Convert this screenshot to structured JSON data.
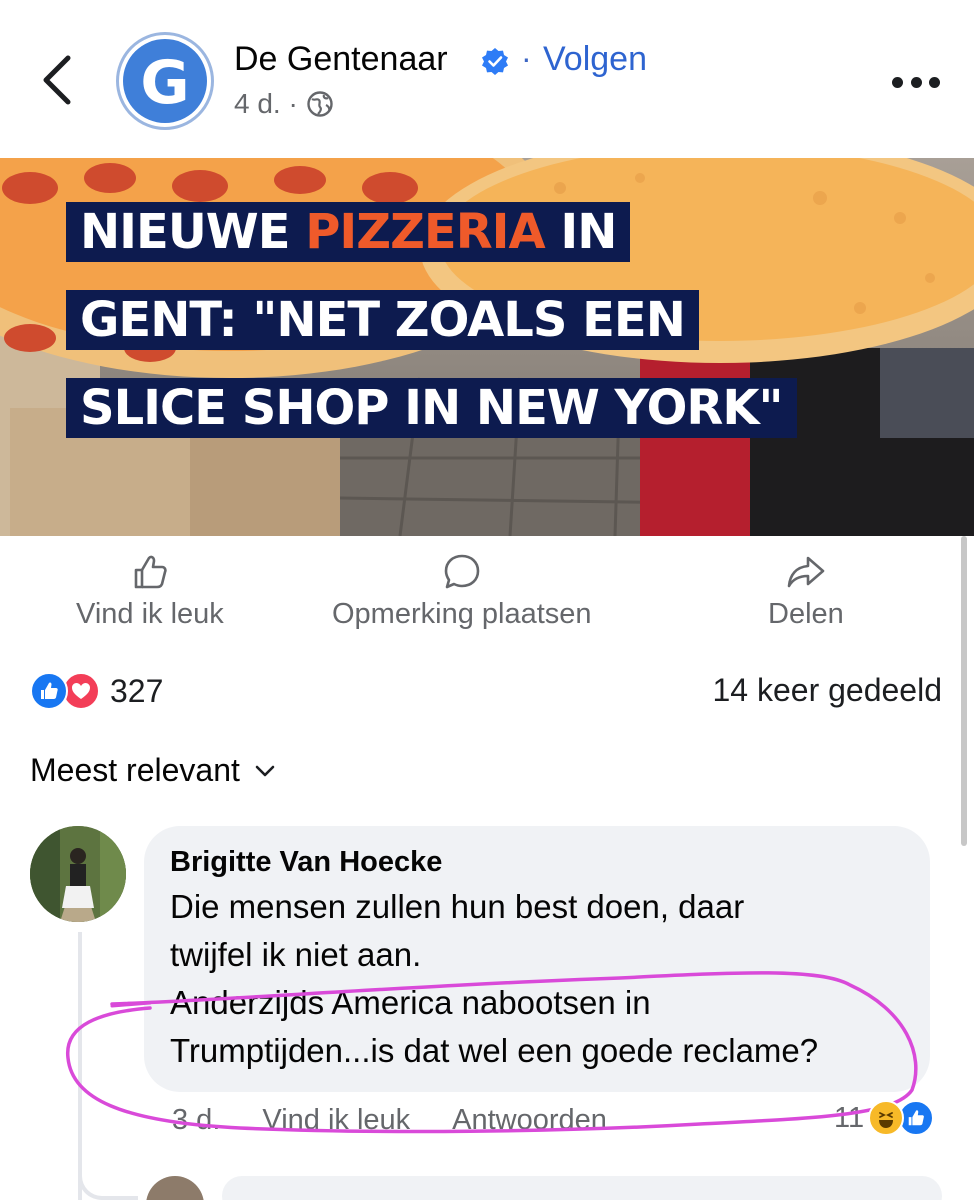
{
  "header": {
    "page_name": "De Gentenaar",
    "logo_letter": "G",
    "follow_label": "Volgen",
    "separator": "·",
    "time": "4 d. ·"
  },
  "post": {
    "headline_lines": [
      {
        "before": "NIEUWE ",
        "accent": "PIZZERIA",
        "after": " IN"
      },
      {
        "before": "GENT: \"NET ZOALS EEN",
        "accent": "",
        "after": ""
      },
      {
        "before": "SLICE SHOP IN NEW YORK\"",
        "accent": "",
        "after": ""
      }
    ],
    "colors": {
      "headline_bg": "#0d1b4f",
      "accent": "#ef5a2a"
    }
  },
  "actions": {
    "like_label": "Vind ik leuk",
    "comment_label": "Opmerking plaatsen",
    "share_label": "Delen"
  },
  "stats": {
    "reaction_count": "327",
    "shares_label": "14 keer gedeeld"
  },
  "sort": {
    "label": "Meest relevant"
  },
  "comment": {
    "author": "Brigitte Van Hoecke",
    "lines": [
      "Die mensen zullen hun best doen, daar",
      "twijfel ik niet aan.",
      "Anderzijds America nabootsen in",
      "Trumptijden...is dat wel een goede reclame?"
    ],
    "time": "3 d.",
    "like_label": "Vind ik leuk",
    "reply_label": "Antwoorden",
    "reaction_count": "11"
  },
  "icons": {
    "back": "chevron-left-icon",
    "verified": "verified-badge-icon",
    "globe": "globe-icon",
    "more": "more-horizontal-icon",
    "like": "thumbs-up-icon",
    "comment": "speech-bubble-icon",
    "share": "share-arrow-icon",
    "sort": "chevron-down-icon"
  },
  "colors": {
    "brand_blue": "#1877f2",
    "follow_blue": "#2e64d0",
    "annotation": "#d94ad9"
  }
}
